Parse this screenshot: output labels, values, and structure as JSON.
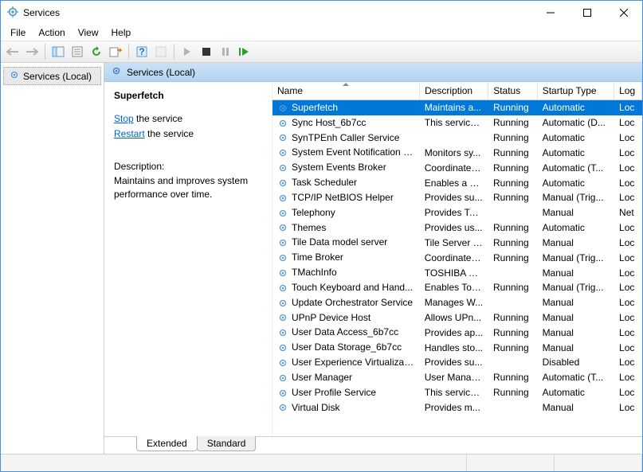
{
  "window": {
    "title": "Services"
  },
  "menubar": [
    "File",
    "Action",
    "View",
    "Help"
  ],
  "nav": {
    "label": "Services (Local)"
  },
  "content_header": "Services (Local)",
  "detail": {
    "selected_name": "Superfetch",
    "stop_link": "Stop",
    "stop_suffix": " the service",
    "restart_link": "Restart",
    "restart_suffix": " the service",
    "desc_label": "Description:",
    "desc_text": "Maintains and improves system performance over time."
  },
  "columns": {
    "name": "Name",
    "description": "Description",
    "status": "Status",
    "startup": "Startup Type",
    "logon": "Log"
  },
  "rows": [
    {
      "name": "Superfetch",
      "description": "Maintains a...",
      "status": "Running",
      "startup": "Automatic",
      "logon": "Loc",
      "selected": true
    },
    {
      "name": "Sync Host_6b7cc",
      "description": "This service ...",
      "status": "Running",
      "startup": "Automatic (D...",
      "logon": "Loc"
    },
    {
      "name": "SynTPEnh Caller Service",
      "description": "",
      "status": "Running",
      "startup": "Automatic",
      "logon": "Loc"
    },
    {
      "name": "System Event Notification S...",
      "description": "Monitors sy...",
      "status": "Running",
      "startup": "Automatic",
      "logon": "Loc"
    },
    {
      "name": "System Events Broker",
      "description": "Coordinates...",
      "status": "Running",
      "startup": "Automatic (T...",
      "logon": "Loc"
    },
    {
      "name": "Task Scheduler",
      "description": "Enables a us...",
      "status": "Running",
      "startup": "Automatic",
      "logon": "Loc"
    },
    {
      "name": "TCP/IP NetBIOS Helper",
      "description": "Provides su...",
      "status": "Running",
      "startup": "Manual (Trig...",
      "logon": "Loc"
    },
    {
      "name": "Telephony",
      "description": "Provides Tel...",
      "status": "",
      "startup": "Manual",
      "logon": "Net"
    },
    {
      "name": "Themes",
      "description": "Provides us...",
      "status": "Running",
      "startup": "Automatic",
      "logon": "Loc"
    },
    {
      "name": "Tile Data model server",
      "description": "Tile Server f...",
      "status": "Running",
      "startup": "Manual",
      "logon": "Loc"
    },
    {
      "name": "Time Broker",
      "description": "Coordinates...",
      "status": "Running",
      "startup": "Manual (Trig...",
      "logon": "Loc"
    },
    {
      "name": "TMachInfo",
      "description": "TOSHIBA M...",
      "status": "",
      "startup": "Manual",
      "logon": "Loc"
    },
    {
      "name": "Touch Keyboard and Hand...",
      "description": "Enables Tou...",
      "status": "Running",
      "startup": "Manual (Trig...",
      "logon": "Loc"
    },
    {
      "name": "Update Orchestrator Service",
      "description": "Manages W...",
      "status": "",
      "startup": "Manual",
      "logon": "Loc"
    },
    {
      "name": "UPnP Device Host",
      "description": "Allows UPn...",
      "status": "Running",
      "startup": "Manual",
      "logon": "Loc"
    },
    {
      "name": "User Data Access_6b7cc",
      "description": "Provides ap...",
      "status": "Running",
      "startup": "Manual",
      "logon": "Loc"
    },
    {
      "name": "User Data Storage_6b7cc",
      "description": "Handles sto...",
      "status": "Running",
      "startup": "Manual",
      "logon": "Loc"
    },
    {
      "name": "User Experience Virtualizatio...",
      "description": "Provides su...",
      "status": "",
      "startup": "Disabled",
      "logon": "Loc"
    },
    {
      "name": "User Manager",
      "description": "User Manag...",
      "status": "Running",
      "startup": "Automatic (T...",
      "logon": "Loc"
    },
    {
      "name": "User Profile Service",
      "description": "This service ...",
      "status": "Running",
      "startup": "Automatic",
      "logon": "Loc"
    },
    {
      "name": "Virtual Disk",
      "description": "Provides m...",
      "status": "",
      "startup": "Manual",
      "logon": "Loc"
    }
  ],
  "tabs": {
    "extended": "Extended",
    "standard": "Standard"
  }
}
